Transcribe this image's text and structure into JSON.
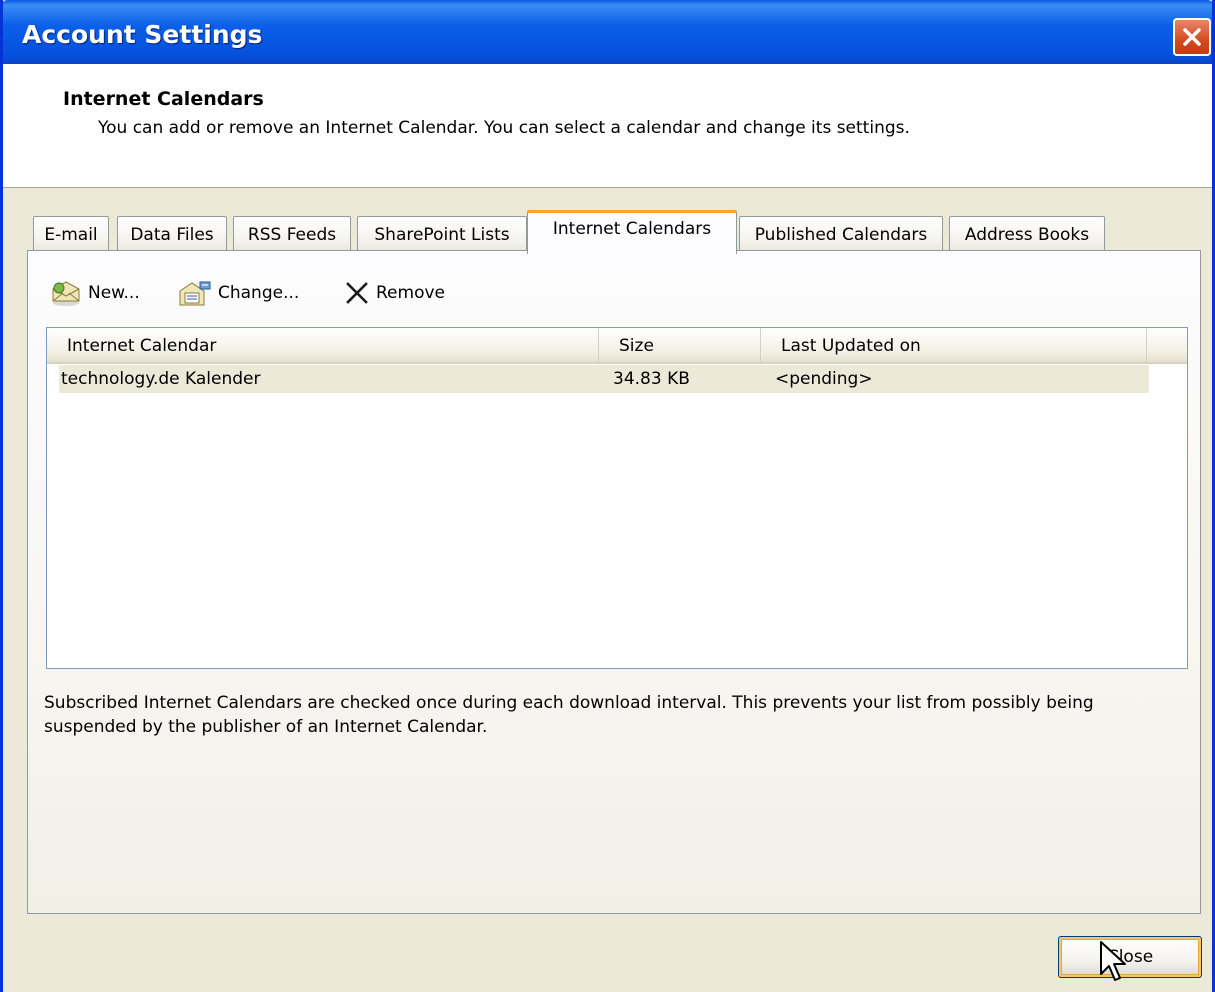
{
  "window": {
    "title": "Account Settings"
  },
  "header": {
    "title": "Internet Calendars",
    "description": "You can add or remove an Internet Calendar. You can select a calendar and change its settings."
  },
  "tabs": [
    {
      "label": "E-mail"
    },
    {
      "label": "Data Files"
    },
    {
      "label": "RSS Feeds"
    },
    {
      "label": "SharePoint Lists"
    },
    {
      "label": "Internet Calendars",
      "active": true
    },
    {
      "label": "Published Calendars"
    },
    {
      "label": "Address Books"
    }
  ],
  "toolbar": {
    "new_label": "New...",
    "change_label": "Change...",
    "remove_label": "Remove"
  },
  "list": {
    "columns": [
      "Internet Calendar",
      "Size",
      "Last Updated on"
    ],
    "rows": [
      {
        "name": "technology.de Kalender",
        "size": "34.83 KB",
        "updated": "<pending>"
      }
    ]
  },
  "info": "Subscribed Internet Calendars are checked once during each download interval. This prevents your list from possibly being suspended by the publisher of an Internet Calendar.",
  "footer": {
    "close_label": "Close"
  },
  "colors": {
    "titlebar": "#0b5fe8",
    "active_tab_accent": "#f5a623",
    "window_bg": "#ece9d8"
  },
  "icons": [
    "close-icon",
    "new-calendar-icon",
    "change-calendar-icon",
    "remove-icon",
    "mouse-cursor-icon"
  ]
}
